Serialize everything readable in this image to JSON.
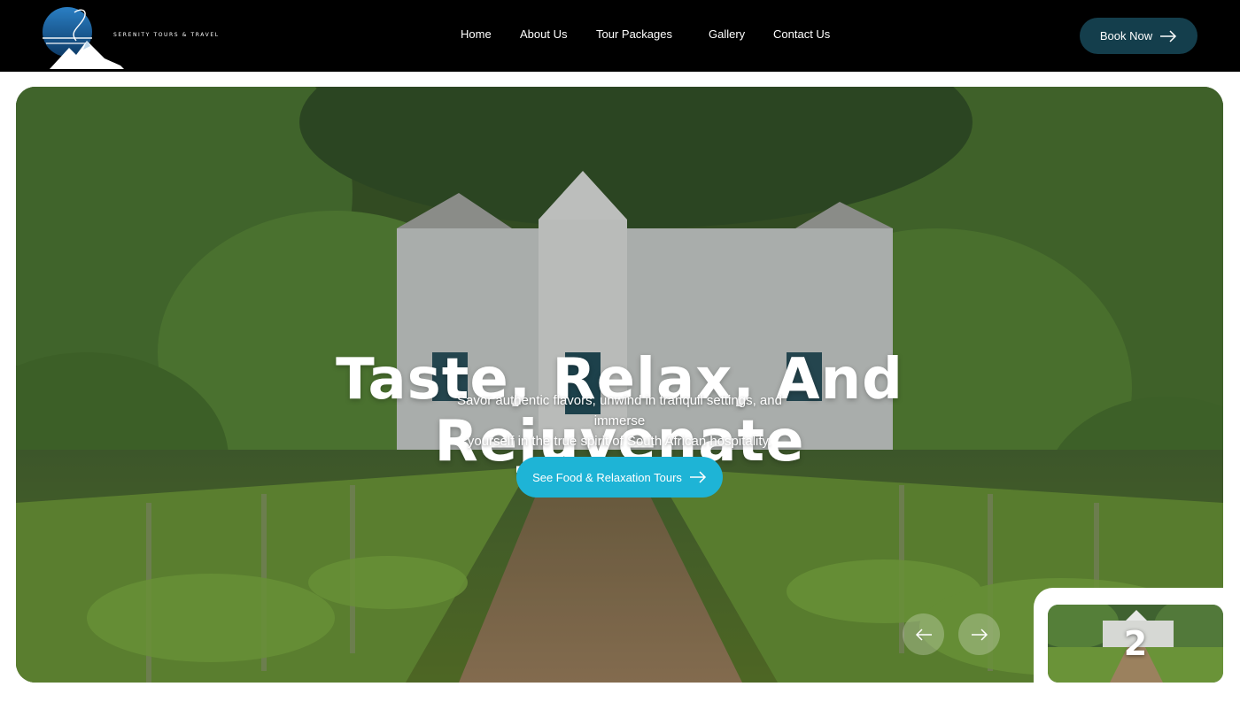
{
  "brand": {
    "name": "SERENITY TOURS & TRAVEL"
  },
  "nav": {
    "items": [
      {
        "label": "Home"
      },
      {
        "label": "About Us"
      },
      {
        "label": "Tour Packages"
      },
      {
        "label": "Gallery"
      },
      {
        "label": "Contact Us"
      }
    ],
    "book_label": "Book Now"
  },
  "hero": {
    "headline_line1": "Taste, Relax, And",
    "headline_line2": "Rejuvenate",
    "subtext_line1": "Savor authentic flavors, unwind in tranquil settings, and immerse",
    "subtext_line2": "yourself in the true spirit of South African hospitality.",
    "cta_label": "See Food & Relaxation Tours",
    "prev_icon": "arrow-left-icon",
    "next_icon": "arrow-right-icon"
  },
  "slider": {
    "next_thumb_number": "2"
  },
  "colors": {
    "topbar": "#000000",
    "book_button": "#143e4c",
    "cta_button": "#1eb4d6",
    "text": "#ffffff"
  }
}
